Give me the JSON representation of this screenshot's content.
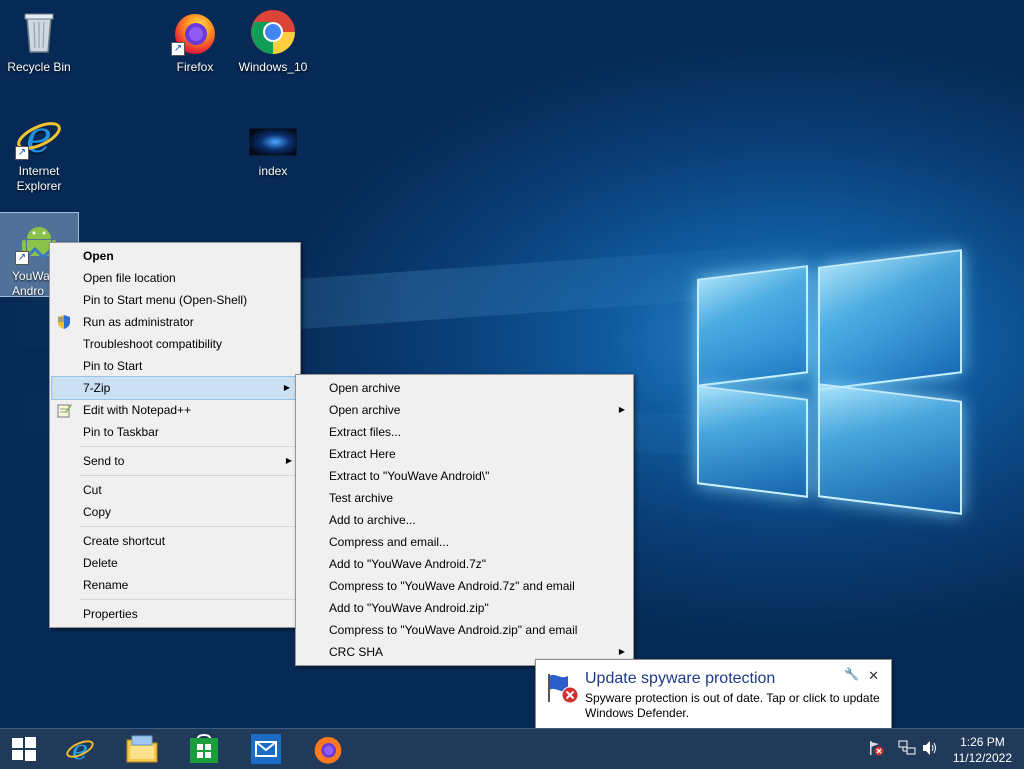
{
  "desktop": {
    "icons": [
      {
        "label": "Recycle Bin"
      },
      {
        "label": "Firefox"
      },
      {
        "label": "Windows_10"
      },
      {
        "label": "Internet Explorer"
      },
      {
        "label": "index"
      },
      {
        "label": "YouWave Android",
        "label_visible": "YouWa Andro"
      }
    ]
  },
  "context_menu": {
    "items": [
      {
        "label": "Open"
      },
      {
        "label": "Open file location"
      },
      {
        "label": "Pin to Start menu (Open-Shell)"
      },
      {
        "label": "Run as administrator"
      },
      {
        "label": "Troubleshoot compatibility"
      },
      {
        "label": "Pin to Start"
      },
      {
        "label": "7-Zip"
      },
      {
        "label": "Edit with Notepad++"
      },
      {
        "label": "Pin to Taskbar"
      },
      {
        "label": "Send to"
      },
      {
        "label": "Cut"
      },
      {
        "label": "Copy"
      },
      {
        "label": "Create shortcut"
      },
      {
        "label": "Delete"
      },
      {
        "label": "Rename"
      },
      {
        "label": "Properties"
      }
    ]
  },
  "submenu_7zip": {
    "items": [
      {
        "label": "Open archive"
      },
      {
        "label": "Open archive"
      },
      {
        "label": "Extract files..."
      },
      {
        "label": "Extract Here"
      },
      {
        "label": "Extract to \"YouWave Android\\\""
      },
      {
        "label": "Test archive"
      },
      {
        "label": "Add to archive..."
      },
      {
        "label": "Compress and email..."
      },
      {
        "label": "Add to \"YouWave Android.7z\""
      },
      {
        "label": "Compress to \"YouWave Android.7z\" and email"
      },
      {
        "label": "Add to \"YouWave Android.zip\""
      },
      {
        "label": "Compress to \"YouWave Android.zip\" and email"
      },
      {
        "label": "CRC SHA"
      }
    ]
  },
  "notification": {
    "title": "Update spyware protection",
    "body": "Spyware protection is out of date. Tap or click to update Windows Defender."
  },
  "taskbar": {
    "clock_time": "1:26 PM",
    "clock_date": "11/12/2022"
  },
  "colors": {
    "menu_bg": "#f0f0f0",
    "menu_highlight": "#cce0f4",
    "taskbar": "#183252",
    "notification_title": "#1e3a8a"
  }
}
